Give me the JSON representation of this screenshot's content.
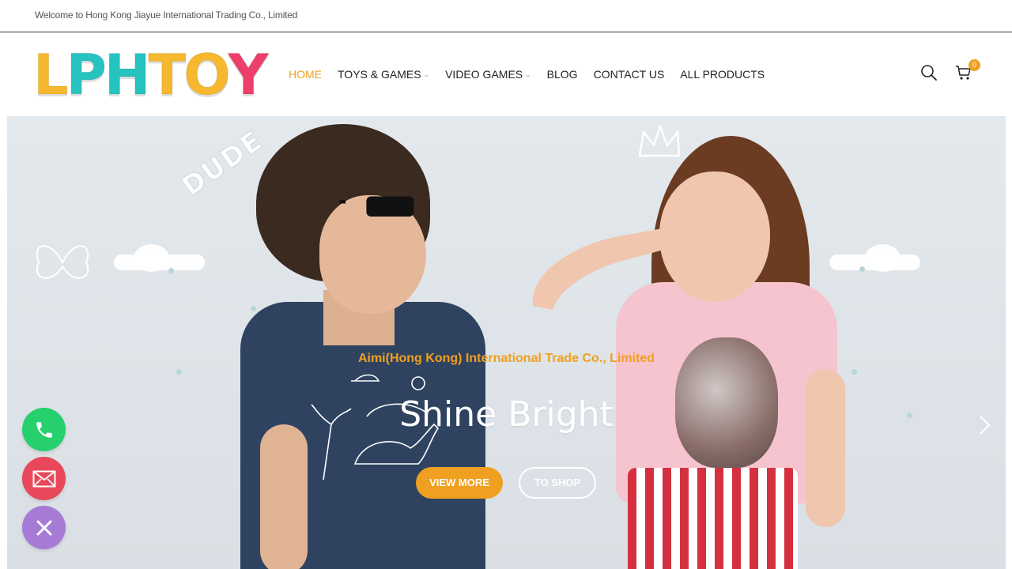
{
  "topbar": {
    "welcome": "Welcome to Hong Kong Jiayue International Trading Co., Limited"
  },
  "logo": {
    "letters": [
      "L",
      "P",
      "H",
      "T",
      "O",
      "Y"
    ],
    "colors": [
      "#f5b82e",
      "#27c3c0",
      "#27c3c0",
      "#f5b82e",
      "#f5b82e",
      "#ee3e6a"
    ]
  },
  "nav": {
    "items": [
      {
        "label": "HOME",
        "active": true,
        "dropdown": false
      },
      {
        "label": "TOYS & GAMES",
        "active": false,
        "dropdown": true
      },
      {
        "label": "VIDEO GAMES",
        "active": false,
        "dropdown": true
      },
      {
        "label": "BLOG",
        "active": false,
        "dropdown": false
      },
      {
        "label": "CONTACT US",
        "active": false,
        "dropdown": false
      },
      {
        "label": "ALL PRODUCTS",
        "active": false,
        "dropdown": false
      }
    ],
    "chevron": "⌄"
  },
  "header_icons": {
    "search": "search-icon",
    "cart": "cart-icon",
    "cart_count": "0"
  },
  "hero": {
    "subtitle": "Aimi(Hong Kong) International Trade Co., Limited",
    "title": "Shine Bright",
    "primary_button": "VIEW MORE",
    "secondary_button": "TO SHOP",
    "doodle_text": "DUDE"
  },
  "floating": {
    "phone": "phone-icon",
    "mail": "mail-icon",
    "close": "close-icon"
  },
  "colors": {
    "accent": "#f0a020",
    "phone": "#25d06d",
    "mail": "#e8485a",
    "close": "#a77ad6"
  }
}
